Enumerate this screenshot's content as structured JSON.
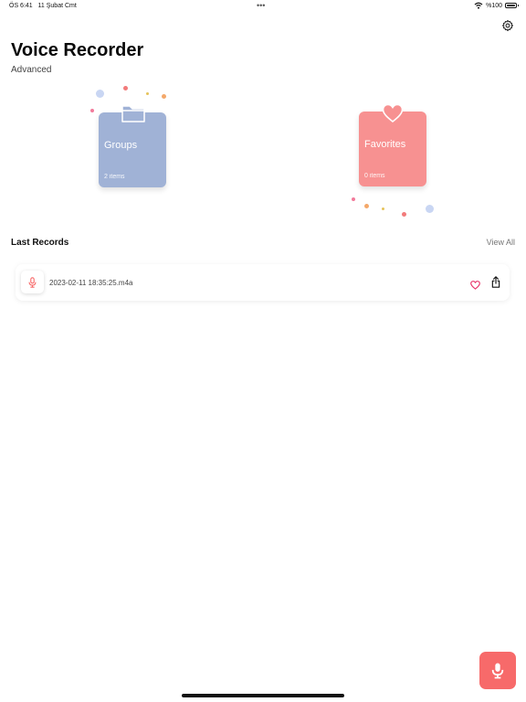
{
  "status_bar": {
    "time": "ÖS 6:41",
    "date": "11 Şubat Cmt",
    "dots": "•••",
    "battery": "%100"
  },
  "header": {
    "title": "Voice Recorder",
    "subtitle": "Advanced"
  },
  "cards": {
    "groups": {
      "label": "Groups",
      "count": "2 items",
      "color": "#a0b2d6"
    },
    "favorites": {
      "label": "Favorites",
      "count": "0 items",
      "color": "#f79191"
    }
  },
  "last_records": {
    "title": "Last Records",
    "view_all": "View All",
    "items": [
      {
        "name": "2023-02-11 18:35:25.m4a"
      }
    ]
  },
  "colors": {
    "accent": "#f76a6a",
    "heart": "#e8356a"
  },
  "icons": {
    "settings": "gear-icon",
    "record": "microphone-icon",
    "favorite": "heart-icon",
    "share": "share-icon"
  }
}
